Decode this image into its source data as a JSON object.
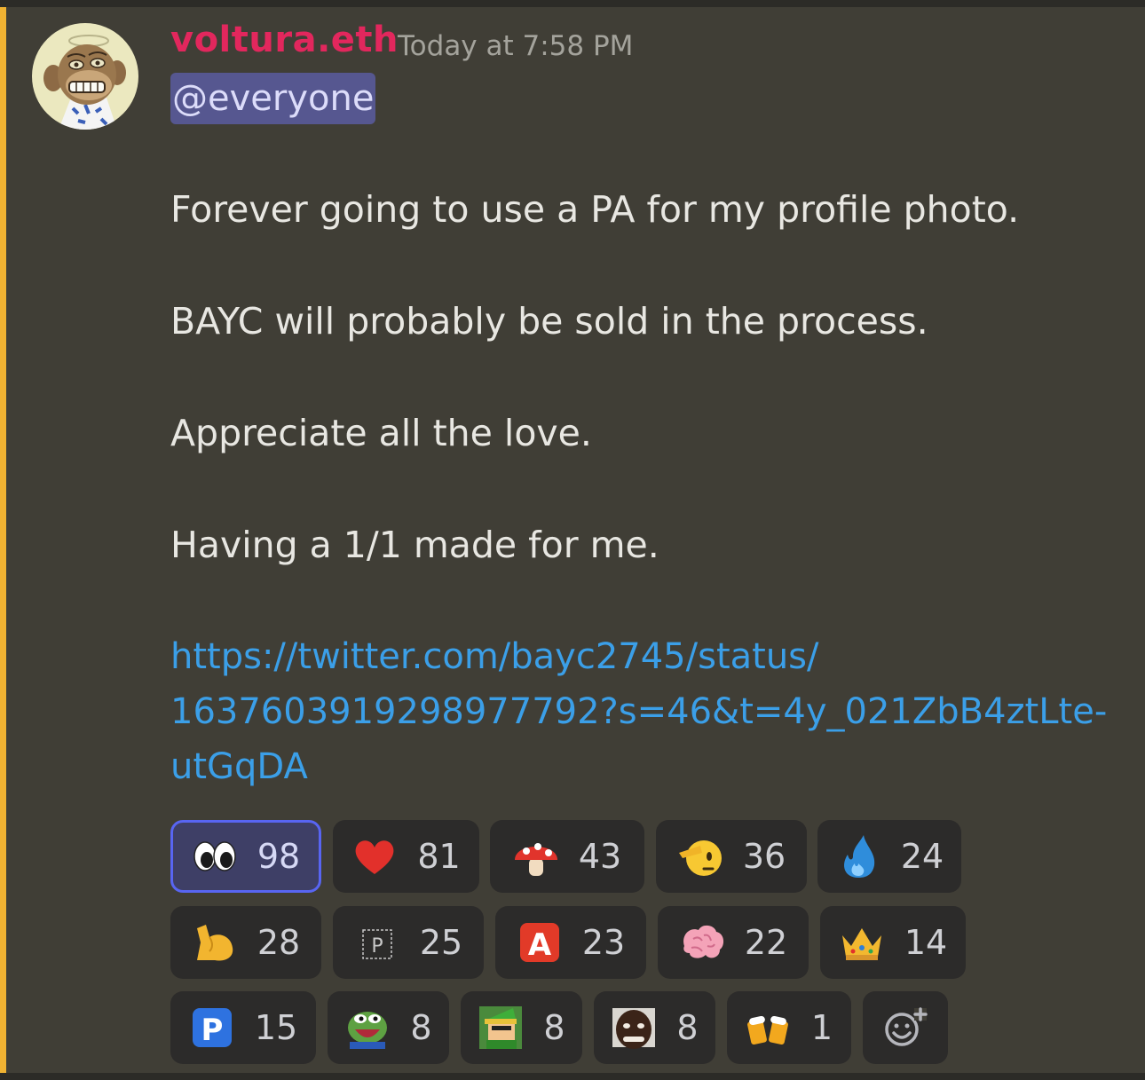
{
  "message": {
    "author": "voltura.eth",
    "timestamp": "Today at 7:58 PM",
    "mention": "@everyone",
    "lines": [
      "Forever going to use a PA for my profile photo.",
      "BAYC will probably be sold in the process.",
      "Appreciate all the love.",
      "Having a 1/1 made for me."
    ],
    "link_lines": [
      "https://twitter.com/bayc2745/status/",
      "1637603919298977792?s=46&t=4y_021ZbB4ztLte-",
      "utGqDA"
    ]
  },
  "reactions": [
    {
      "name": "eyes-emoji",
      "count": "98",
      "selected": true
    },
    {
      "name": "red-heart-emoji",
      "count": "81"
    },
    {
      "name": "mushroom-emoji",
      "count": "43"
    },
    {
      "name": "saluting-face-emoji",
      "count": "36"
    },
    {
      "name": "blue-fire-emoji",
      "count": "24"
    },
    {
      "name": "flexed-biceps-emoji",
      "count": "28"
    },
    {
      "name": "p-letter-emoji",
      "count": "25",
      "glyph": "P"
    },
    {
      "name": "a-button-emoji",
      "count": "23",
      "glyph": "A"
    },
    {
      "name": "brain-emoji",
      "count": "22"
    },
    {
      "name": "crown-emoji",
      "count": "14"
    },
    {
      "name": "p-button-emoji",
      "count": "15",
      "glyph": "P"
    },
    {
      "name": "pepe-emoji",
      "count": "8"
    },
    {
      "name": "link-character-emoji",
      "count": "8"
    },
    {
      "name": "face-emoji",
      "count": "8"
    },
    {
      "name": "beer-mugs-emoji",
      "count": "1"
    },
    {
      "name": "add-reaction-icon"
    }
  ],
  "colors": {
    "background": "#403e36",
    "username": "#e2275d",
    "link": "#3b9fe8",
    "mention_bg": "#565790",
    "highlight_bar": "#f0b232",
    "selected_border": "#5865f2"
  }
}
